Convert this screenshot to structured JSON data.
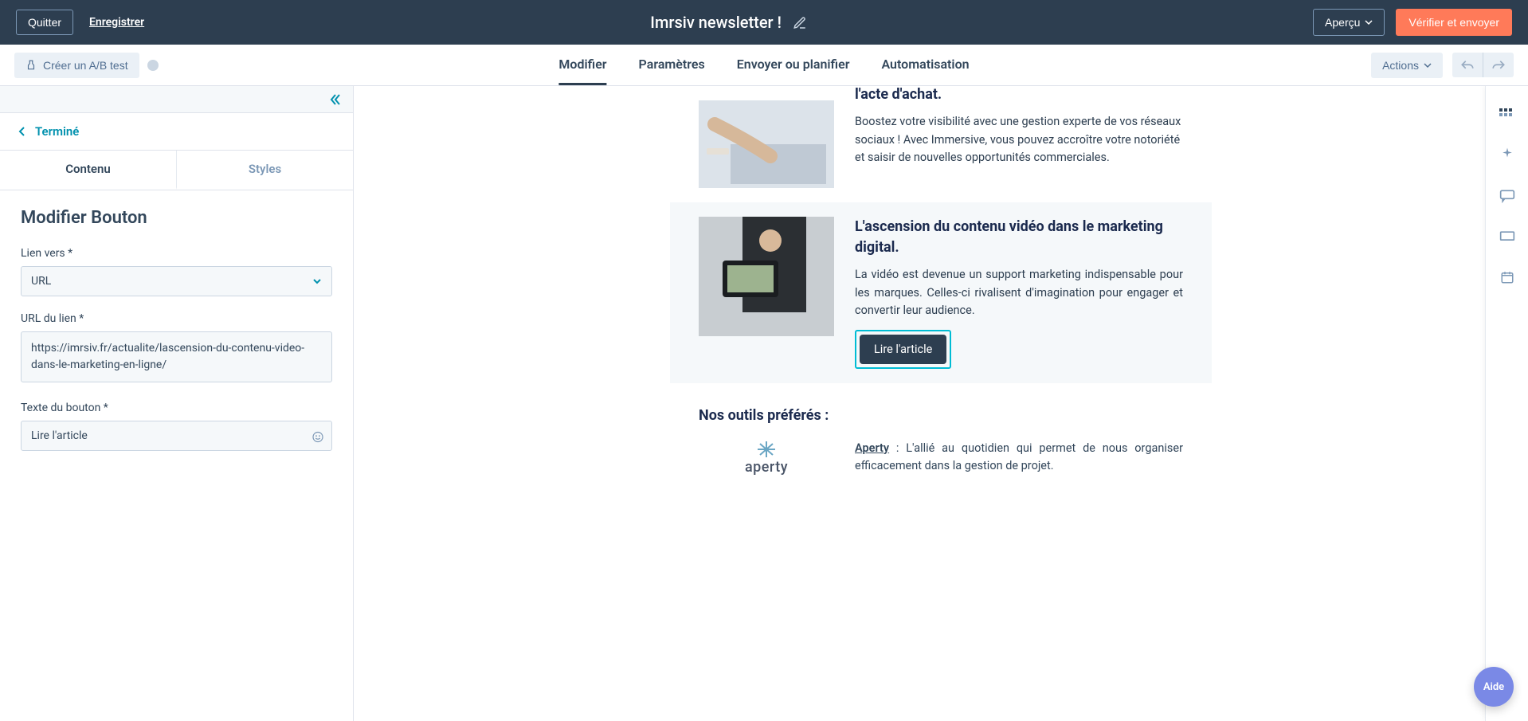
{
  "top": {
    "quit": "Quitter",
    "save": "Enregistrer",
    "title": "Imrsiv newsletter !",
    "preview": "Aperçu",
    "verify": "Vérifier et envoyer"
  },
  "sub": {
    "ab": "Créer un A/B test",
    "tabs": [
      "Modifier",
      "Paramètres",
      "Envoyer ou planifier",
      "Automatisation"
    ],
    "actions": "Actions"
  },
  "left": {
    "done": "Terminé",
    "tab_content": "Contenu",
    "tab_styles": "Styles",
    "heading": "Modifier Bouton",
    "link_to_label": "Lien vers *",
    "link_to_value": "URL",
    "url_label": "URL du lien *",
    "url_value": "https://imrsiv.fr/actualite/lascension-du-contenu-video-dans-le-marketing-en-ligne/",
    "btn_text_label": "Texte du bouton *",
    "btn_text_value": "Lire l'article"
  },
  "email": {
    "block1": {
      "heading_partial": "l'acte d'achat.",
      "body": "Boostez votre visibilité avec une gestion experte de vos réseaux sociaux ! Avec Immersive, vous pouvez accroître votre notoriété et saisir de nouvelles opportunités commerciales."
    },
    "block2": {
      "heading": "L'ascension du contenu vidéo dans le marketing digital.",
      "body": "La vidéo est devenue un support marketing indispensable pour les marques. Celles-ci rivalisent d'imagination pour engager et convertir leur audience.",
      "button": "Lire l'article"
    },
    "tools": {
      "heading": "Nos outils préférés :",
      "logo_text": "aperty",
      "brand": "Aperty",
      "desc_rest": " : L'allié au quotidien qui permet de nous organiser efficacement dans la gestion de projet."
    }
  },
  "help": "Aide"
}
